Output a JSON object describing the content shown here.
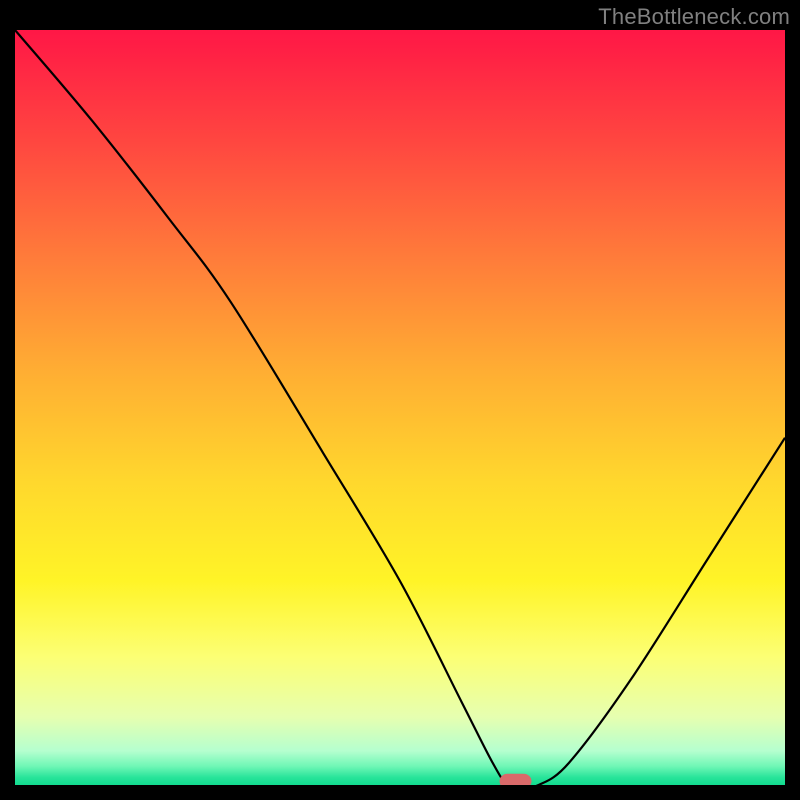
{
  "watermark": "TheBottleneck.com",
  "chart_data": {
    "type": "line",
    "title": "",
    "xlabel": "",
    "ylabel": "",
    "xlim": [
      0,
      100
    ],
    "ylim": [
      0,
      100
    ],
    "x": [
      0,
      10,
      20,
      28,
      40,
      50,
      58,
      62,
      64,
      66,
      68,
      72,
      80,
      90,
      100
    ],
    "values": [
      100,
      88,
      75,
      64,
      44,
      27,
      11,
      3,
      0,
      0,
      0,
      3,
      14,
      30,
      46
    ],
    "marker": {
      "x": 65,
      "y": 0.5,
      "color": "#d96a6a"
    },
    "gradient_stops": [
      {
        "offset": 0.0,
        "color": "#ff1746"
      },
      {
        "offset": 0.15,
        "color": "#ff4740"
      },
      {
        "offset": 0.3,
        "color": "#ff7b3a"
      },
      {
        "offset": 0.45,
        "color": "#ffad33"
      },
      {
        "offset": 0.6,
        "color": "#ffd82d"
      },
      {
        "offset": 0.73,
        "color": "#fff427"
      },
      {
        "offset": 0.83,
        "color": "#fcff74"
      },
      {
        "offset": 0.91,
        "color": "#e6ffb0"
      },
      {
        "offset": 0.955,
        "color": "#b5ffcf"
      },
      {
        "offset": 0.975,
        "color": "#70f7b6"
      },
      {
        "offset": 0.99,
        "color": "#28e49a"
      },
      {
        "offset": 1.0,
        "color": "#11db8f"
      }
    ]
  }
}
